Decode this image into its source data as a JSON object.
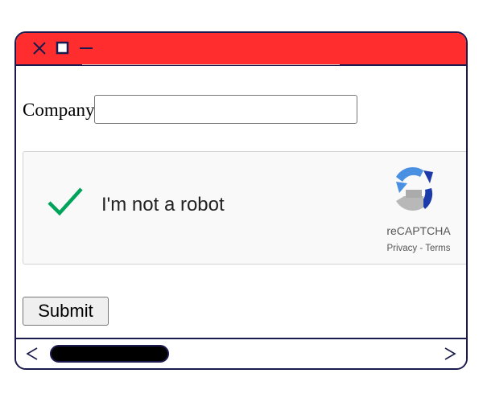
{
  "window": {
    "titlebar_color": "#ff2d2d",
    "frame_color": "#1a1a4e",
    "controls": {
      "close_icon": "close-icon",
      "maximize_icon": "maximize-icon",
      "minimize_icon": "minimize-icon"
    }
  },
  "form": {
    "company_label": "Company",
    "company_value": "",
    "submit_label": "Submit"
  },
  "recaptcha": {
    "checkbox_label": "I'm not a robot",
    "checked": true,
    "check_color": "#00a35a",
    "brand": "reCAPTCHA",
    "privacy_label": "Privacy",
    "separator": " - ",
    "terms_label": "Terms"
  },
  "scrollbar": {
    "left_glyph": "<",
    "right_glyph": ">"
  }
}
